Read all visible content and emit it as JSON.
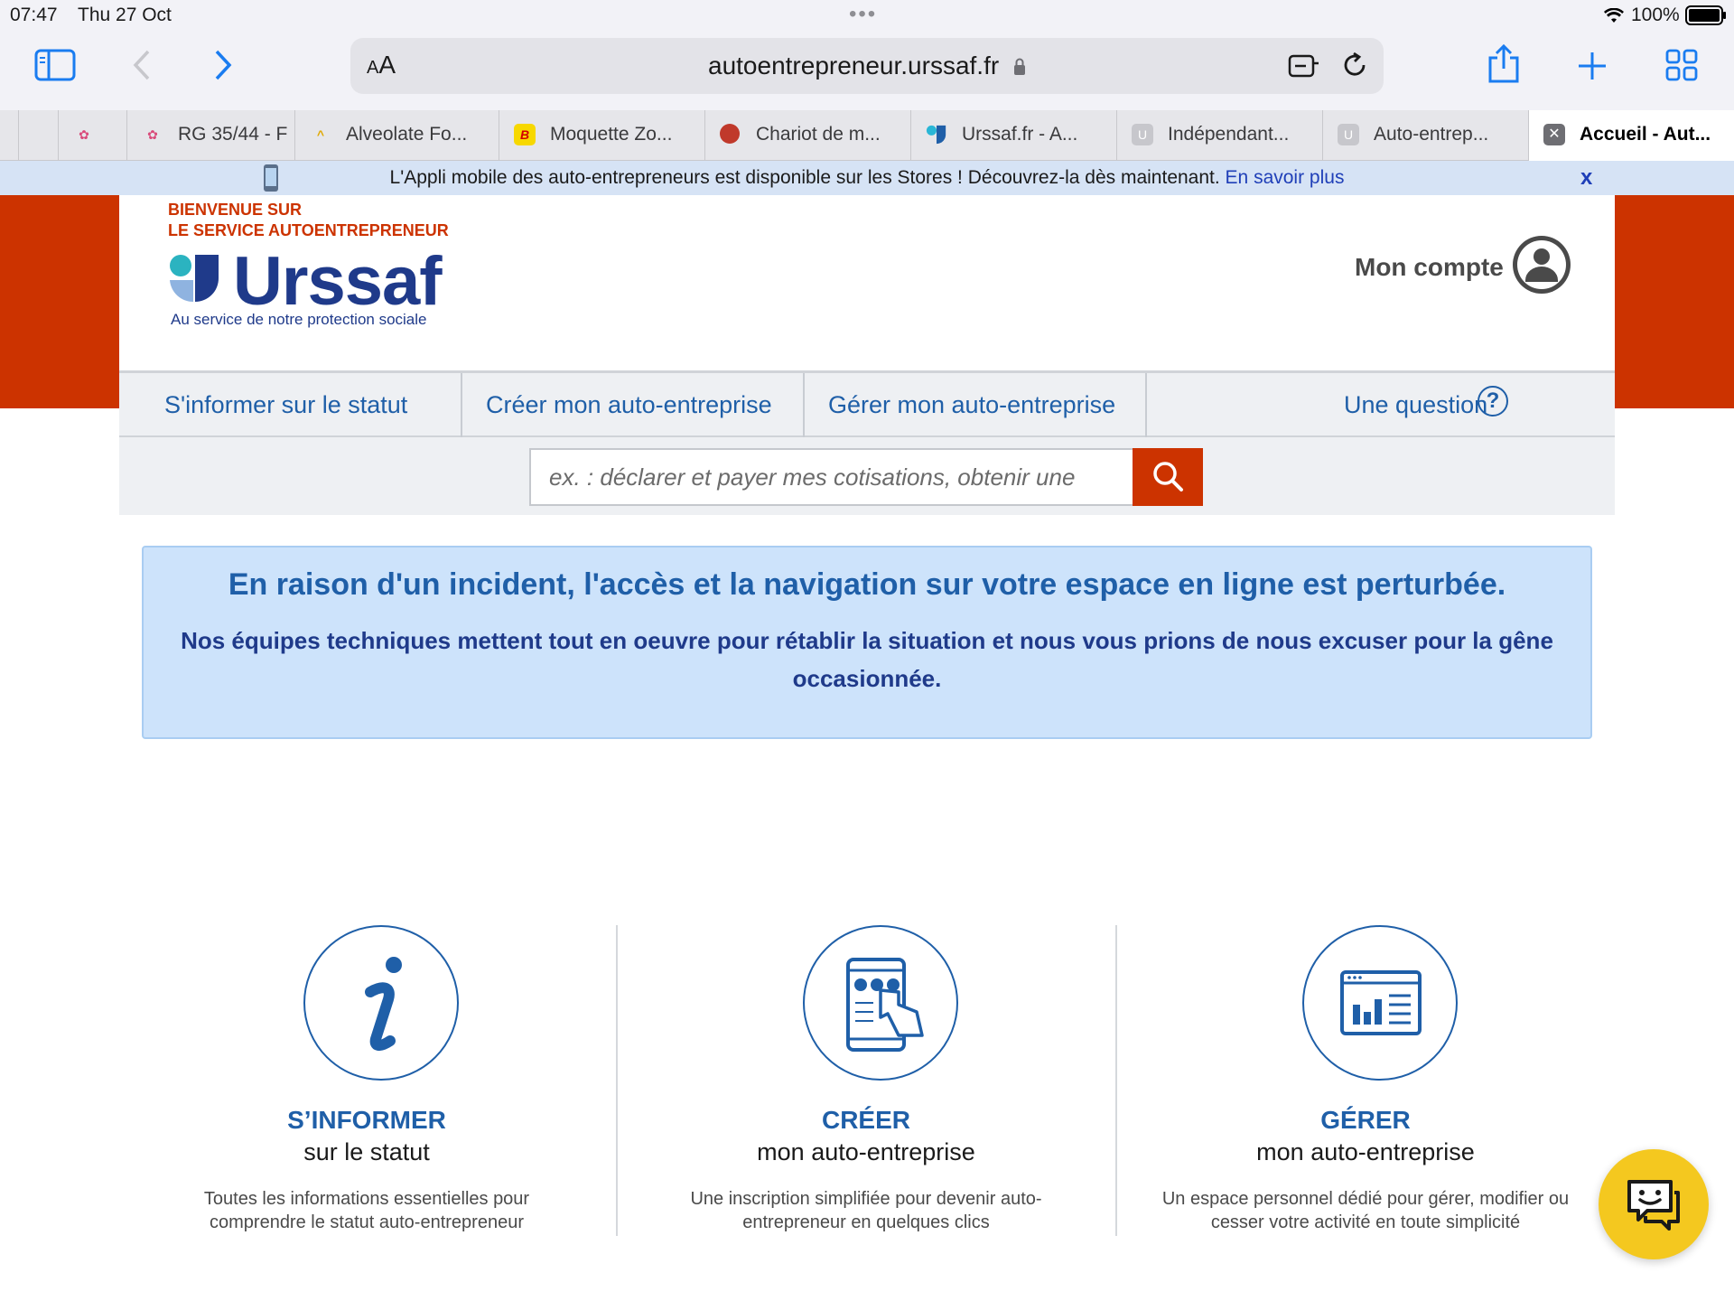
{
  "status_bar": {
    "time": "07:47",
    "date": "Thu 27 Oct",
    "battery": "100%"
  },
  "browser": {
    "aa_label_small": "A",
    "aa_label_large": "A",
    "url": "autoentrepreneur.urssaf.fr",
    "tabs": [
      {
        "label": "RG 35/44 - F",
        "icon": "flower-icon"
      },
      {
        "label": "Alveolate Fo...",
        "icon": "chevron-logo-icon"
      },
      {
        "label": "Moquette Zo...",
        "icon": "b-logo-icon"
      },
      {
        "label": "Chariot de m...",
        "icon": "red-ball-icon"
      },
      {
        "label": "Urssaf.fr - A...",
        "icon": "urssaf-logo-icon"
      },
      {
        "label": "Indépendant...",
        "icon": "u-letter-icon"
      },
      {
        "label": "Auto-entrep...",
        "icon": "u-letter-icon"
      },
      {
        "label": "Accueil - Aut...",
        "icon": "close-icon"
      }
    ]
  },
  "app_banner": {
    "message": "L'Appli mobile des auto-entrepreneurs est disponible sur les Stores ! Découvrez-la dès maintenant. ",
    "link": "En savoir plus",
    "close": "x"
  },
  "header": {
    "welcome_line1": "BIENVENUE SUR",
    "welcome_line2": "LE SERVICE AUTOENTREPRENEUR",
    "logo_word": "Urssaf",
    "tagline": "Au service de notre protection sociale",
    "account_label": "Mon compte"
  },
  "nav": {
    "items": [
      "S'informer sur le statut",
      "Créer mon auto-entreprise",
      "Gérer mon auto-entreprise"
    ],
    "question": "Une question",
    "question_mark": "?"
  },
  "search": {
    "placeholder": "ex. : déclarer et payer mes cotisations, obtenir une"
  },
  "alert": {
    "heading": "En raison d'un incident, l'accès et la navigation sur votre espace en ligne est perturbée.",
    "body": "Nos équipes techniques mettent tout en oeuvre pour rétablir la situation et nous vous prions de nous excuser pour la gêne occasionnée."
  },
  "features": [
    {
      "title": "S’INFORMER",
      "subtitle": "sur le statut",
      "description": "Toutes les informations essentielles pour comprendre le statut auto-entrepreneur",
      "icon": "info-icon"
    },
    {
      "title": "CRÉER",
      "subtitle": "mon auto-entreprise",
      "description": "Une inscription simplifiée pour devenir auto-entrepreneur en quelques clics",
      "icon": "tablet-touch-icon"
    },
    {
      "title": "GÉRER",
      "subtitle": "mon auto-entreprise",
      "description": "Un espace personnel dédié pour gérer, modifier ou cesser votre activité en toute simplicité",
      "icon": "dashboard-chart-icon"
    }
  ],
  "colors": {
    "brand_red": "#cc3300",
    "brand_blue": "#1f5fa8",
    "alert_bg": "#cde3fb",
    "chat_yellow": "#f4c81f"
  }
}
